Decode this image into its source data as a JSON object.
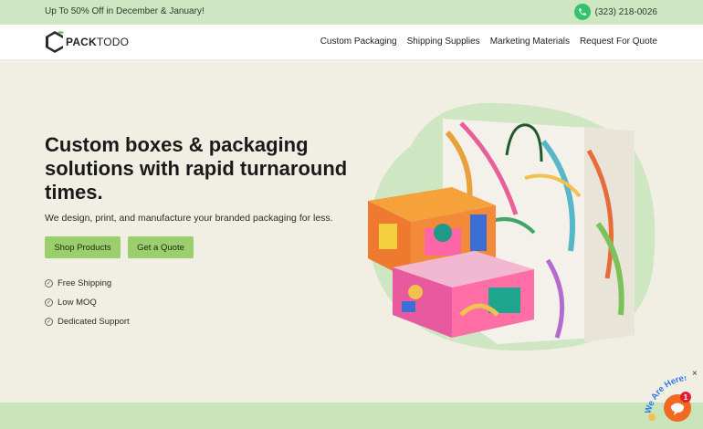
{
  "topbar": {
    "promo": "Up To 50% Off in December & January!",
    "phone": "(323) 218-0026",
    "phone_icon": "phone-icon"
  },
  "brand": {
    "logo_text_bold": "PACK",
    "logo_text_rest": "TODO"
  },
  "nav": {
    "items": [
      {
        "label": "Custom Packaging"
      },
      {
        "label": "Shipping Supplies"
      },
      {
        "label": "Marketing Materials"
      },
      {
        "label": "Request For Quote"
      }
    ]
  },
  "hero": {
    "title": "Custom boxes & packaging solutions with rapid turnaround times.",
    "subtitle": "We design, print, and manufacture your branded packaging for less.",
    "primary_button": "Shop Products",
    "secondary_button": "Get a Quote",
    "features": [
      "Free Shipping",
      "Low MOQ",
      "Dedicated Support"
    ]
  },
  "chat": {
    "label": "We Are Here!",
    "badge": "1",
    "close": "×"
  },
  "colors": {
    "accent_green": "#9bcf6e",
    "topbar_green": "#cfe6c3",
    "background": "#f1efe4",
    "chat_orange": "#f26a21"
  }
}
